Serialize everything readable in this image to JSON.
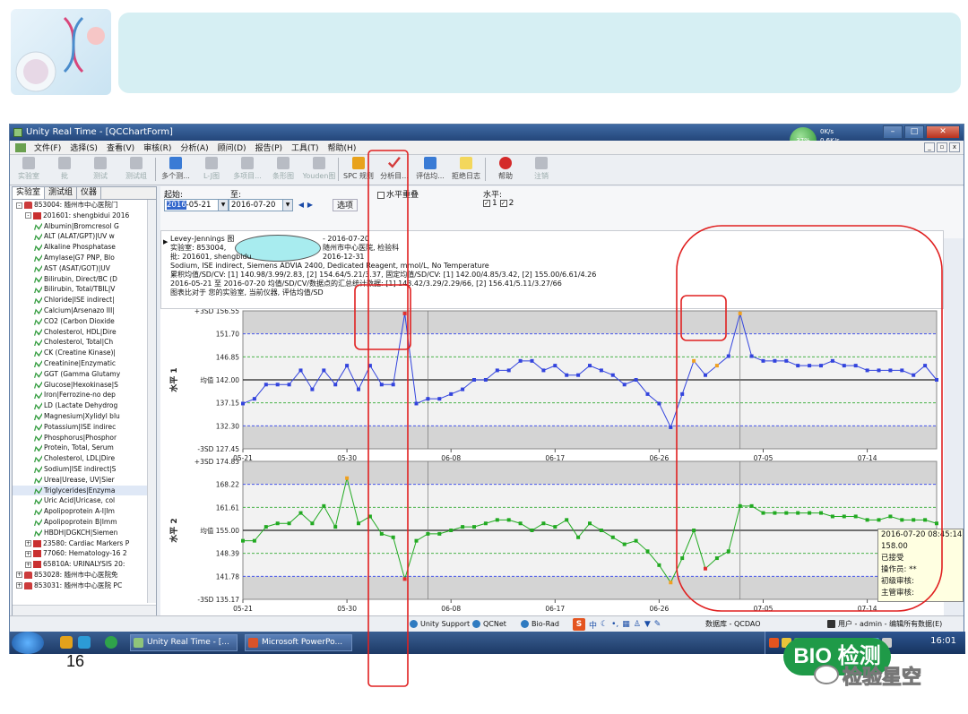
{
  "window": {
    "title": "Unity Real Time - [QCChartForm]"
  },
  "net": {
    "pct": "37%",
    "up": "0K/s",
    "down": "0.6K/s"
  },
  "menu": [
    "文件(F)",
    "选择(S)",
    "查看(V)",
    "审核(R)",
    "分析(A)",
    "顾问(D)",
    "报告(P)",
    "工具(T)",
    "帮助(H)"
  ],
  "toolbar": [
    {
      "label": "实验室",
      "state": "dis"
    },
    {
      "label": "批",
      "state": "dis"
    },
    {
      "label": "测试",
      "state": "dis"
    },
    {
      "label": "测试组",
      "state": "dis"
    },
    {
      "label": "多个测...",
      "state": "en"
    },
    {
      "label": "L-J图",
      "state": "dis"
    },
    {
      "label": "多项目...",
      "state": "dis"
    },
    {
      "label": "条形图",
      "state": "dis"
    },
    {
      "label": "Youden图",
      "state": "dis"
    },
    {
      "label": "SPC 规则",
      "state": "flag"
    },
    {
      "label": "分析目...",
      "state": "chk"
    },
    {
      "label": "评估均...",
      "state": "en"
    },
    {
      "label": "拒绝日志",
      "state": "doc"
    },
    {
      "label": "帮助",
      "state": "red"
    },
    {
      "label": "注销",
      "state": "dis"
    }
  ],
  "tabs": [
    "实验室",
    "测试组",
    "仪器"
  ],
  "tree": [
    {
      "level": 0,
      "pm": "-",
      "icon": "home",
      "label": "853004: 随州市中心医院门"
    },
    {
      "level": 1,
      "pm": "-",
      "icon": "box",
      "label": "201601: shengbidui 2016"
    },
    {
      "level": 2,
      "icon": "test",
      "label": "Albumin|Bromcresol G"
    },
    {
      "level": 2,
      "icon": "test",
      "label": "ALT (ALAT/GPT)|UV w"
    },
    {
      "level": 2,
      "icon": "test",
      "label": "Alkaline Phosphatase"
    },
    {
      "level": 2,
      "icon": "test",
      "label": "Amylase|G7 PNP, Blo"
    },
    {
      "level": 2,
      "icon": "test",
      "label": "AST (ASAT/GOT)|UV"
    },
    {
      "level": 2,
      "icon": "test",
      "label": "Bilirubin, Direct/BC (D"
    },
    {
      "level": 2,
      "icon": "test",
      "label": "Bilirubin, Total/TBIL|V"
    },
    {
      "level": 2,
      "icon": "test",
      "label": "Chloride|ISE indirect|"
    },
    {
      "level": 2,
      "icon": "test",
      "label": "Calcium|Arsenazo III|"
    },
    {
      "level": 2,
      "icon": "test",
      "label": "CO2 (Carbon Dioxide"
    },
    {
      "level": 2,
      "icon": "test",
      "label": "Cholesterol, HDL|Dire"
    },
    {
      "level": 2,
      "icon": "test",
      "label": "Cholesterol, Total|Ch"
    },
    {
      "level": 2,
      "icon": "test",
      "label": "CK (Creatine Kinase)|"
    },
    {
      "level": 2,
      "icon": "test",
      "label": "Creatinine|Enzymatic"
    },
    {
      "level": 2,
      "icon": "test",
      "label": "GGT (Gamma Glutamy"
    },
    {
      "level": 2,
      "icon": "test",
      "label": "Glucose|Hexokinase|S"
    },
    {
      "level": 2,
      "icon": "test",
      "label": "Iron|Ferrozine-no dep"
    },
    {
      "level": 2,
      "icon": "test",
      "label": "LD (Lactate Dehydrog"
    },
    {
      "level": 2,
      "icon": "test",
      "label": "Magnesium|Xylidyl blu"
    },
    {
      "level": 2,
      "icon": "test",
      "label": "Potassium|ISE indirec"
    },
    {
      "level": 2,
      "icon": "test",
      "label": "Phosphorus|Phosphor"
    },
    {
      "level": 2,
      "icon": "test",
      "label": "Protein, Total, Serum"
    },
    {
      "level": 2,
      "icon": "test",
      "label": "Cholesterol, LDL|Dire"
    },
    {
      "level": 2,
      "icon": "test",
      "label": "Sodium|ISE indirect|S"
    },
    {
      "level": 2,
      "icon": "test",
      "label": "Urea|Urease, UV|Sier"
    },
    {
      "level": 2,
      "icon": "test",
      "label": "Triglycerides|Enzyma"
    },
    {
      "level": 2,
      "icon": "test",
      "label": "Uric Acid|Uricase, col"
    },
    {
      "level": 2,
      "icon": "test",
      "label": "Apolipoprotein A-I|Im"
    },
    {
      "level": 2,
      "icon": "test",
      "label": "Apolipoprotein B|Imm"
    },
    {
      "level": 2,
      "icon": "test",
      "label": "HBDH|DGKCH|Siemen"
    },
    {
      "level": 1,
      "pm": "+",
      "icon": "box",
      "label": "23580: Cardiac Markers P"
    },
    {
      "level": 1,
      "pm": "+",
      "icon": "box",
      "label": "77060: Hematology-16 2"
    },
    {
      "level": 1,
      "pm": "+",
      "icon": "box",
      "label": "65810A: URINALYSIS 20:"
    },
    {
      "level": 0,
      "pm": "+",
      "icon": "home",
      "label": "853028: 随州市中心医院免"
    },
    {
      "level": 0,
      "pm": "+",
      "icon": "home",
      "label": "853031: 随州市中心医院 PC"
    }
  ],
  "filters": {
    "start_label": "起始:",
    "end_label": "至:",
    "start": "2016-05-21",
    "start_sel": "2016",
    "start_rest": "-05-21",
    "end": "2016-07-20",
    "options": "选项",
    "overlay_label": "水平重叠",
    "level_label": "水平:",
    "lvl1": "1",
    "lvl2": "2"
  },
  "info": [
    "Levey-Jennings 图",
    "实验室: 853004, ",
    "批: 201601, shengbidu",
    "Sodium, ISE indirect, Siemens ADVIA 2400, Dedicated Reagent, mmol/L, No Temperature",
    "累积均值/SD/CV: [1] 140.98/3.99/2.83, [2] 154.64/5.21/3.37,  固定均值/SD/CV: [1] 142.00/4.85/3.42, [2] 155.00/6.61/4.26",
    "2016-05-21 至 2016-07-20 均值/SD/CV/数据点的汇总统计数据:  [1] 143.42/3.29/2.29/66, [2] 156.41/5.11/3.27/66",
    "图表比对于  您的实验室, 当前仪器, 评估均值/SD"
  ],
  "info_r1": "- 2016-07-20",
  "info_r2": "随州市中心医院, 检验科",
  "info_r3": "2016-12-31",
  "chart_data": [
    {
      "type": "line",
      "ylabel": "水平 1",
      "mean": 142.0,
      "ylim": [
        127.45,
        156.55
      ],
      "yticks": [
        {
          "v": 156.55,
          "t": "+3SD 156.55"
        },
        {
          "v": 151.7,
          "t": "151.70"
        },
        {
          "v": 146.85,
          "t": "146.85"
        },
        {
          "v": 142.0,
          "t": "均值 142.00"
        },
        {
          "v": 137.15,
          "t": "137.15"
        },
        {
          "v": 132.3,
          "t": "132.30"
        },
        {
          "v": 127.45,
          "t": "-3SD 127.45"
        }
      ],
      "xticks": [
        "05-21",
        "05-30",
        "06-08",
        "06-17",
        "06-26",
        "07-05",
        "07-14"
      ],
      "x_days": [
        0,
        1,
        2,
        3,
        4,
        5,
        6,
        7,
        8,
        9,
        10,
        11,
        12,
        13,
        14,
        15,
        16,
        17,
        18,
        19,
        20,
        21,
        22,
        23,
        24,
        25,
        26,
        27,
        28,
        29,
        30,
        31,
        32,
        33,
        34,
        35,
        36,
        37,
        38,
        39,
        40,
        41,
        42,
        43,
        44,
        45,
        46,
        47,
        48,
        49,
        50,
        51,
        52,
        53,
        54,
        55,
        56,
        57,
        58,
        59,
        60
      ],
      "values": [
        137,
        138,
        141,
        141,
        141,
        144,
        140,
        144,
        141,
        145,
        140,
        145,
        141,
        141,
        156,
        137,
        138,
        138,
        139,
        140,
        142,
        142,
        144,
        144,
        146,
        146,
        144,
        145,
        143,
        143,
        145,
        144,
        143,
        141,
        142,
        139,
        137,
        132,
        139,
        146,
        143,
        145,
        147,
        156,
        147,
        146,
        146,
        146,
        145,
        145,
        145,
        146,
        145,
        145,
        144,
        144,
        144,
        144,
        143,
        145,
        142
      ],
      "series_color": "#3344dd",
      "violations": [
        14,
        39,
        41,
        43
      ]
    },
    {
      "type": "line",
      "ylabel": "水平 2",
      "mean": 155.0,
      "ylim": [
        135.17,
        174.83
      ],
      "yticks": [
        {
          "v": 174.83,
          "t": "+3SD 174.83"
        },
        {
          "v": 168.22,
          "t": "168.22"
        },
        {
          "v": 161.61,
          "t": "161.61"
        },
        {
          "v": 155.0,
          "t": "均值 155.00"
        },
        {
          "v": 148.39,
          "t": "148.39"
        },
        {
          "v": 141.78,
          "t": "141.78"
        },
        {
          "v": 135.17,
          "t": "-3SD 135.17"
        }
      ],
      "xticks": [
        "05-21",
        "05-30",
        "06-08",
        "06-17",
        "06-26",
        "07-05",
        "07-14"
      ],
      "x_days": [
        0,
        1,
        2,
        3,
        4,
        5,
        6,
        7,
        8,
        9,
        10,
        11,
        12,
        13,
        14,
        15,
        16,
        17,
        18,
        19,
        20,
        21,
        22,
        23,
        24,
        25,
        26,
        27,
        28,
        29,
        30,
        31,
        32,
        33,
        34,
        35,
        36,
        37,
        38,
        39,
        40,
        41,
        42,
        43,
        44,
        45,
        46,
        47,
        48,
        49,
        50,
        51,
        52,
        53,
        54,
        55,
        56,
        57,
        58,
        59,
        60
      ],
      "values": [
        152,
        152,
        156,
        157,
        157,
        160,
        157,
        162,
        156,
        170,
        157,
        159,
        154,
        153,
        141,
        152,
        154,
        154,
        155,
        156,
        156,
        157,
        158,
        158,
        157,
        155,
        157,
        156,
        158,
        153,
        157,
        155,
        153,
        151,
        152,
        149,
        145,
        140,
        147,
        155,
        144,
        147,
        149,
        162,
        162,
        160,
        160,
        160,
        160,
        160,
        160,
        159,
        159,
        159,
        158,
        158,
        159,
        158,
        158,
        158,
        157
      ],
      "series_color": "#22aa22",
      "violations": [
        9,
        14,
        37,
        40
      ]
    }
  ],
  "tooltip": {
    "line1": "2016-07-20 08:45:14",
    "line2": "158.00",
    "line3": "已接受",
    "line4": "操作员: **",
    "line5": "初级审核:",
    "line6": "主管审核:"
  },
  "status": {
    "s1": "Unity Support",
    "s2": "QCNet",
    "s3": "Bio-Rad",
    "db": "数据库 - QCDAO",
    "user": "用户 - admin - 编辑所有数据(E)"
  },
  "ime": {
    "s": "S",
    "zh": "中"
  },
  "taskbar": {
    "t1": "Unity Real Time - [...",
    "t2": "Microsoft PowerPo...",
    "clock": "16:01"
  },
  "page_number": "16",
  "watermark": {
    "logo": "BIO 检测",
    "text": "检验星空"
  }
}
